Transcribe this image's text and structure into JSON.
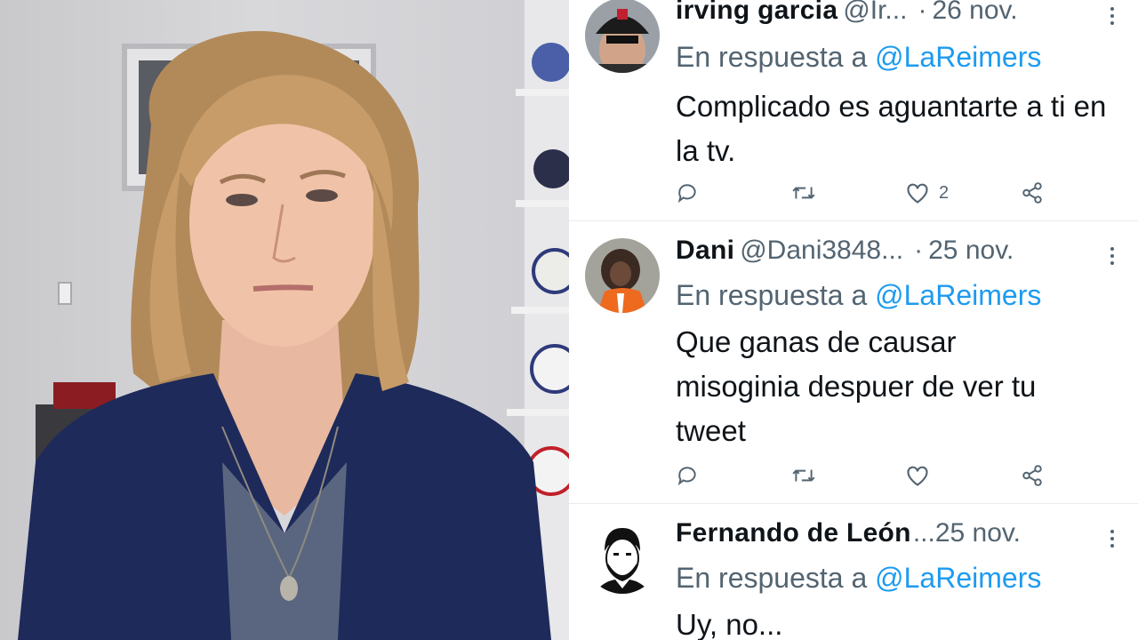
{
  "photo": {
    "description_icon": "person-photo"
  },
  "tweets": [
    {
      "name": "irving garcia",
      "handle": "@Ir...",
      "separator": "·",
      "date": "26 nov.",
      "reply_prefix": "En respuesta a",
      "reply_mention": "@LaReimers",
      "text": "Complicado es aguantarte a ti en la tv.",
      "likes": "2"
    },
    {
      "name": "Dani",
      "handle": "@Dani3848...",
      "separator": "·",
      "date": "25 nov.",
      "reply_prefix": "En respuesta a",
      "reply_mention": "@LaReimers",
      "text": "Que ganas de causar misoginia despuer de ver tu tweet",
      "likes": ""
    },
    {
      "name": "Fernando de León",
      "handle": "...",
      "separator": "",
      "date": "25 nov.",
      "reply_prefix": "En respuesta a",
      "reply_mention": "@LaReimers",
      "text": "Uy, no...",
      "likes": ""
    }
  ],
  "colors": {
    "accent": "#1d9bf0",
    "secondary_text": "#536471",
    "primary_text": "#0f1419"
  }
}
